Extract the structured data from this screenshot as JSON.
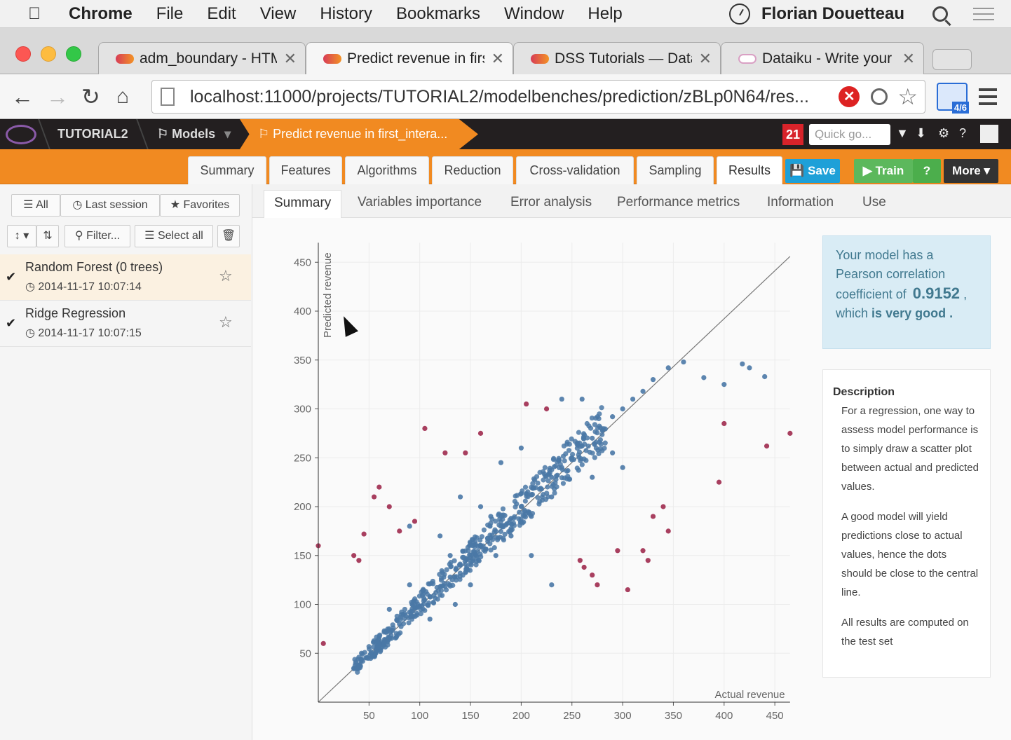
{
  "mac_menu": {
    "app": "Chrome",
    "items": [
      "File",
      "Edit",
      "View",
      "History",
      "Bookmarks",
      "Window",
      "Help"
    ],
    "user": "Florian Douetteau"
  },
  "tabs": [
    {
      "title": "adm_boundary - HTM"
    },
    {
      "title": "Predict revenue in firs"
    },
    {
      "title": "DSS Tutorials — Data"
    },
    {
      "title": "Dataiku - Write your c"
    }
  ],
  "address_bar": {
    "url": "localhost:11000/projects/TUTORIAL2/modelbenches/prediction/zBLp0N64/res..."
  },
  "extension_badge": "4/6",
  "dss_nav": {
    "project": "TUTORIAL2",
    "models": "Models",
    "current": "Predict revenue in first_intera...",
    "notifications": "21",
    "quick_placeholder": "Quick go..."
  },
  "model_tabs": [
    "Summary",
    "Features",
    "Algorithms",
    "Reduction",
    "Cross-validation",
    "Sampling",
    "Results"
  ],
  "model_buttons": {
    "save": "Save",
    "train": "Train",
    "help": "?",
    "more": "More"
  },
  "sidebar": {
    "filters": {
      "all": "All",
      "last_session": "Last session",
      "favorites": "Favorites"
    },
    "tools": {
      "sort": "↕",
      "filter": "Filter...",
      "select_all": "Select all"
    },
    "models": [
      {
        "name": "Random Forest (0 trees)",
        "date": "2014-11-17 10:07:14",
        "selected": true
      },
      {
        "name": "Ridge Regression",
        "date": "2014-11-17 10:07:15",
        "selected": false
      }
    ]
  },
  "result_tabs": [
    "Summary",
    "Variables importance",
    "Error analysis",
    "Performance metrics",
    "Information",
    "Use"
  ],
  "pearson": {
    "text1": "Your model has a Pearson correlation coefficient of",
    "value": "0.9152",
    "text2": ", which",
    "is": "is",
    "verdict": "very good",
    "dot": "."
  },
  "description": {
    "title": "Description",
    "p1": "For a regression, one way to assess model performance is to simply draw a scatter plot between actual and predicted values.",
    "p2": "A good model will yield predictions close to actual values, hence the dots should be close to the central line.",
    "p3": "All results are computed on the test set"
  },
  "colors": {
    "accent": "#f18a21",
    "point_good": "#4a78a6",
    "point_bad": "#9e2a4e",
    "nav_bg": "#231f20"
  },
  "chart_data": {
    "type": "scatter",
    "xlabel": "Actual revenue",
    "ylabel": "Predicted revenue",
    "xlim": [
      0,
      465
    ],
    "ylim": [
      0,
      470
    ],
    "xticks": [
      50,
      100,
      150,
      200,
      250,
      300,
      350,
      400,
      450
    ],
    "yticks": [
      50,
      100,
      150,
      200,
      250,
      300,
      350,
      400,
      450
    ],
    "reference_line": "y = x",
    "series": [
      {
        "points": [
          [
            40,
            38
          ],
          [
            52,
            50
          ],
          [
            60,
            58
          ],
          [
            70,
            66
          ],
          [
            80,
            80
          ],
          [
            90,
            92
          ],
          [
            100,
            98
          ],
          [
            110,
            108
          ],
          [
            120,
            118
          ],
          [
            130,
            128
          ],
          [
            140,
            140
          ],
          [
            150,
            148
          ],
          [
            160,
            160
          ],
          [
            170,
            168
          ],
          [
            180,
            180
          ],
          [
            190,
            188
          ],
          [
            200,
            200
          ],
          [
            210,
            212
          ],
          [
            220,
            218
          ],
          [
            230,
            230
          ],
          [
            240,
            240
          ],
          [
            250,
            248
          ],
          [
            260,
            262
          ],
          [
            270,
            270
          ],
          [
            280,
            278
          ],
          [
            290,
            292
          ],
          [
            300,
            300
          ],
          [
            310,
            310
          ],
          [
            320,
            318
          ],
          [
            330,
            330
          ],
          [
            345,
            342
          ],
          [
            360,
            348
          ],
          [
            380,
            332
          ],
          [
            400,
            325
          ],
          [
            440,
            333
          ],
          [
            425,
            342
          ],
          [
            418,
            346
          ],
          [
            70,
            95
          ],
          [
            90,
            120
          ],
          [
            110,
            85
          ],
          [
            130,
            150
          ],
          [
            150,
            120
          ],
          [
            170,
            190
          ],
          [
            190,
            170
          ],
          [
            210,
            190
          ],
          [
            230,
            210
          ],
          [
            250,
            250
          ],
          [
            270,
            230
          ],
          [
            290,
            255
          ],
          [
            300,
            240
          ],
          [
            260,
            310
          ],
          [
            180,
            245
          ],
          [
            200,
            260
          ],
          [
            120,
            170
          ],
          [
            140,
            210
          ],
          [
            90,
            180
          ],
          [
            160,
            200
          ],
          [
            210,
            150
          ],
          [
            230,
            120
          ],
          [
            240,
            310
          ],
          [
            135,
            100
          ],
          [
            175,
            150
          ]
        ]
      },
      {
        "points": [
          [
            0,
            160
          ],
          [
            5,
            60
          ],
          [
            35,
            150
          ],
          [
            40,
            145
          ],
          [
            45,
            172
          ],
          [
            55,
            210
          ],
          [
            60,
            220
          ],
          [
            70,
            200
          ],
          [
            80,
            175
          ],
          [
            95,
            185
          ],
          [
            105,
            280
          ],
          [
            125,
            255
          ],
          [
            145,
            255
          ],
          [
            160,
            275
          ],
          [
            205,
            305
          ],
          [
            225,
            300
          ],
          [
            258,
            145
          ],
          [
            262,
            138
          ],
          [
            270,
            130
          ],
          [
            275,
            120
          ],
          [
            295,
            155
          ],
          [
            305,
            115
          ],
          [
            320,
            155
          ],
          [
            325,
            145
          ],
          [
            330,
            190
          ],
          [
            340,
            200
          ],
          [
            345,
            175
          ],
          [
            395,
            225
          ],
          [
            400,
            285
          ],
          [
            442,
            262
          ],
          [
            465,
            275
          ]
        ]
      }
    ]
  }
}
